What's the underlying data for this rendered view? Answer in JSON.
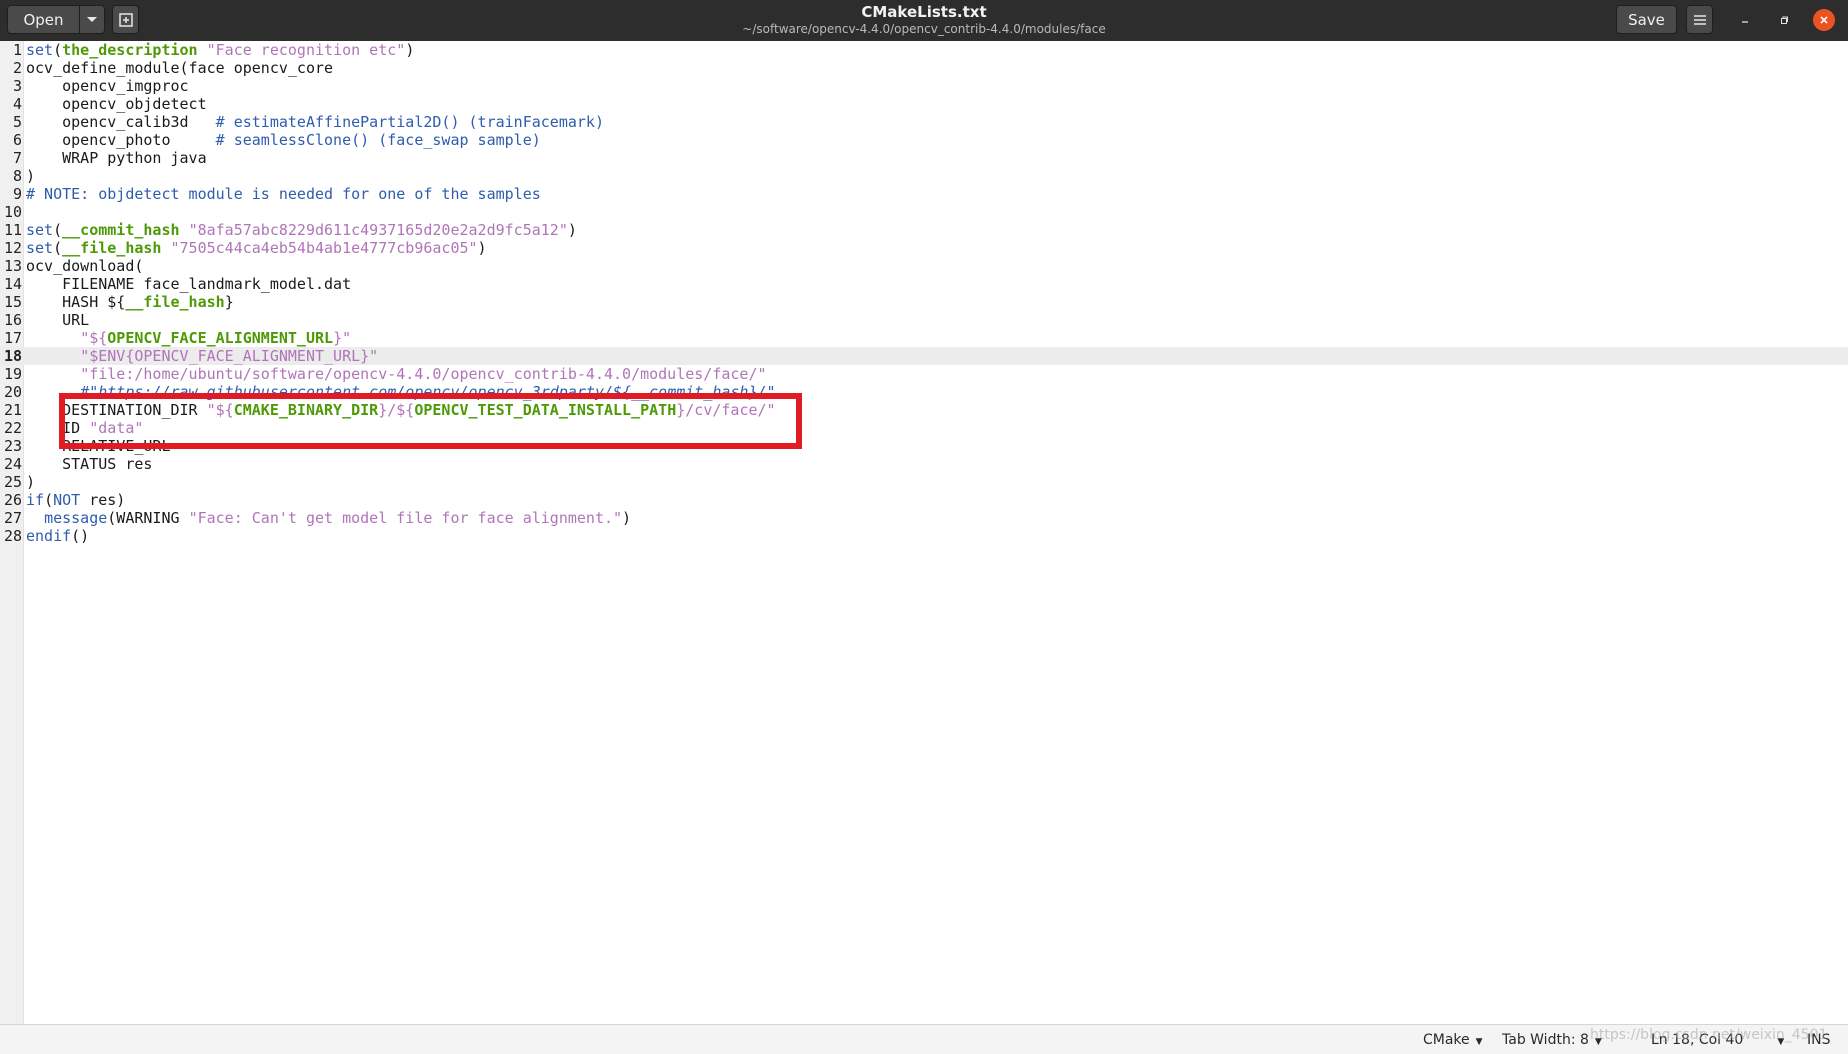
{
  "header": {
    "open_label": "Open",
    "open_menu_icon": "chevron-down-icon",
    "new_tab_icon": "new-document-icon",
    "title": "CMakeLists.txt",
    "subtitle": "~/software/opencv-4.4.0/opencv_contrib-4.4.0/modules/face",
    "save_label": "Save",
    "menu_icon": "hamburger-icon",
    "close_color": "#e95420"
  },
  "editor": {
    "current_line": 18,
    "line_numbers": [
      "1",
      "2",
      "3",
      "4",
      "5",
      "6",
      "7",
      "8",
      "9",
      "10",
      "11",
      "12",
      "13",
      "14",
      "15",
      "16",
      "17",
      "18",
      "19",
      "20",
      "21",
      "22",
      "23",
      "24",
      "25",
      "26",
      "27",
      "28"
    ],
    "lines": [
      "set(the_description \"Face recognition etc\")",
      "ocv_define_module(face opencv_core",
      "    opencv_imgproc",
      "    opencv_objdetect",
      "    opencv_calib3d   # estimateAffinePartial2D() (trainFacemark)",
      "    opencv_photo     # seamlessClone() (face_swap sample)",
      "    WRAP python java",
      ")",
      "# NOTE: objdetect module is needed for one of the samples",
      "",
      "set(__commit_hash \"8afa57abc8229d611c4937165d20e2a2d9fc5a12\")",
      "set(__file_hash \"7505c44ca4eb54b4ab1e4777cb96ac05\")",
      "ocv_download(",
      "    FILENAME face_landmark_model.dat",
      "    HASH ${__file_hash}",
      "    URL",
      "      \"${OPENCV_FACE_ALIGNMENT_URL}\"",
      "      \"$ENV{OPENCV_FACE_ALIGNMENT_URL}\"",
      "      \"file:/home/ubuntu/software/opencv-4.4.0/opencv_contrib-4.4.0/modules/face/\"",
      "      #\"https://raw.githubusercontent.com/opencv/opencv_3rdparty/${__commit_hash}/\"",
      "    DESTINATION_DIR \"${CMAKE_BINARY_DIR}/${OPENCV_TEST_DATA_INSTALL_PATH}/cv/face/\"",
      "    ID \"data\"",
      "    RELATIVE_URL",
      "    STATUS res",
      ")",
      "if(NOT res)",
      "  message(WARNING \"Face: Can't get model file for face alignment.\")",
      "endif()"
    ]
  },
  "statusbar": {
    "language": "CMake",
    "tab_width": "Tab Width: 8",
    "position": "Ln 18, Col 40",
    "mode": "INS",
    "watermark": "https://blog.csdn.net/weixin_4501"
  }
}
